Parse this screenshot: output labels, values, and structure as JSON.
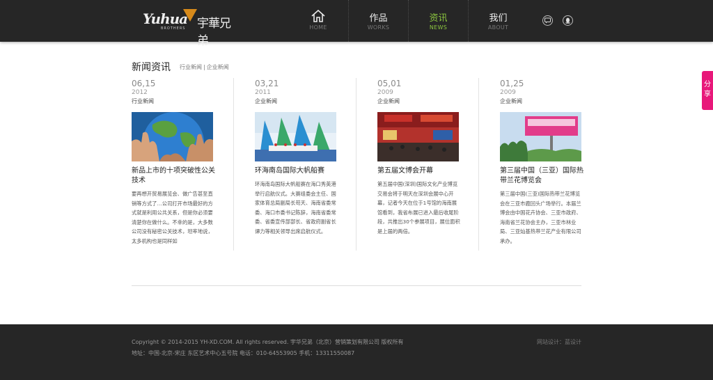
{
  "logo": {
    "script": "Yuhua",
    "sub": "BROTHERS",
    "cn": "宇華兄弟"
  },
  "nav": [
    {
      "cn": "",
      "en": "HOME"
    },
    {
      "cn": "作品",
      "en": "WORKS"
    },
    {
      "cn": "资讯",
      "en": "NEWS"
    },
    {
      "cn": "我们",
      "en": "ABOUT"
    }
  ],
  "share": "分享",
  "section": {
    "title": "新闻资讯",
    "cat1": "行业新闻",
    "sep": "|",
    "cat2": "企业新闻"
  },
  "news": [
    {
      "date": "06,15",
      "year": "2012",
      "category": "行业新闻",
      "title": "新品上市的十项突破性公关技术",
      "excerpt": "要再想开贸易展览会、做广告甚至直销等方式了…公司打开市场最好的方式就是利用公共关系，但是你必须要清楚你在做什么。不幸的是，大多数公司没有秘密公关技术，坦率地说，太多机构也是同样如"
    },
    {
      "date": "03,21",
      "year": "2011",
      "category": "企业新闻",
      "title": "环海南岛国际大帆船赛",
      "excerpt": "环海南岛国际大帆船赛在海口秀英港举行启航仪式。大赛组委会主任、国家体育总局副局长苟天、海南省委常委、海口市委书记陈辞，海南省委常委、省委宣传部部长、省政府副省长谭力等相关领导出席启航仪式。"
    },
    {
      "date": "05,01",
      "year": "2009",
      "category": "企业新闻",
      "title": "第五届文博会开幕",
      "excerpt": "第五届中国(深圳)国际文化产业博览交易会将于明天在深圳会展中心开幕，记者今天在位于1号馆的海南展馆看到，我省布展已进入最后收尾阶段，共推出30个参展项目，展位面积是上届的两倍。"
    },
    {
      "date": "01,25",
      "year": "2009",
      "category": "企业新闻",
      "title": "第三届中国（三亚）国际热带兰花博览会",
      "excerpt": "第三届中国(三亚)国际热带兰花博览会在三亚市鹿回头广场举行。本届兰博会由中国花卉协会、三亚市政府、海南省兰花协会主办，三亚市林业局、三亚灿基热带兰花产业有限公司承办。"
    }
  ],
  "footer": {
    "copyright": "Copyright © 2014-2015 YH-XD.COM. All rights reserved. 宇华兄弟（北京）营销策划有限公司 版权所有",
    "address": "地址：中国-北京-宋庄 东区艺术中心五号院 电话：010-64553905 手机：13311550087",
    "design": "网站设计：蓝设计"
  },
  "colors": {
    "header_bg": "#262626",
    "accent_green": "#8cc63f",
    "share_pink": "#e8187a"
  }
}
